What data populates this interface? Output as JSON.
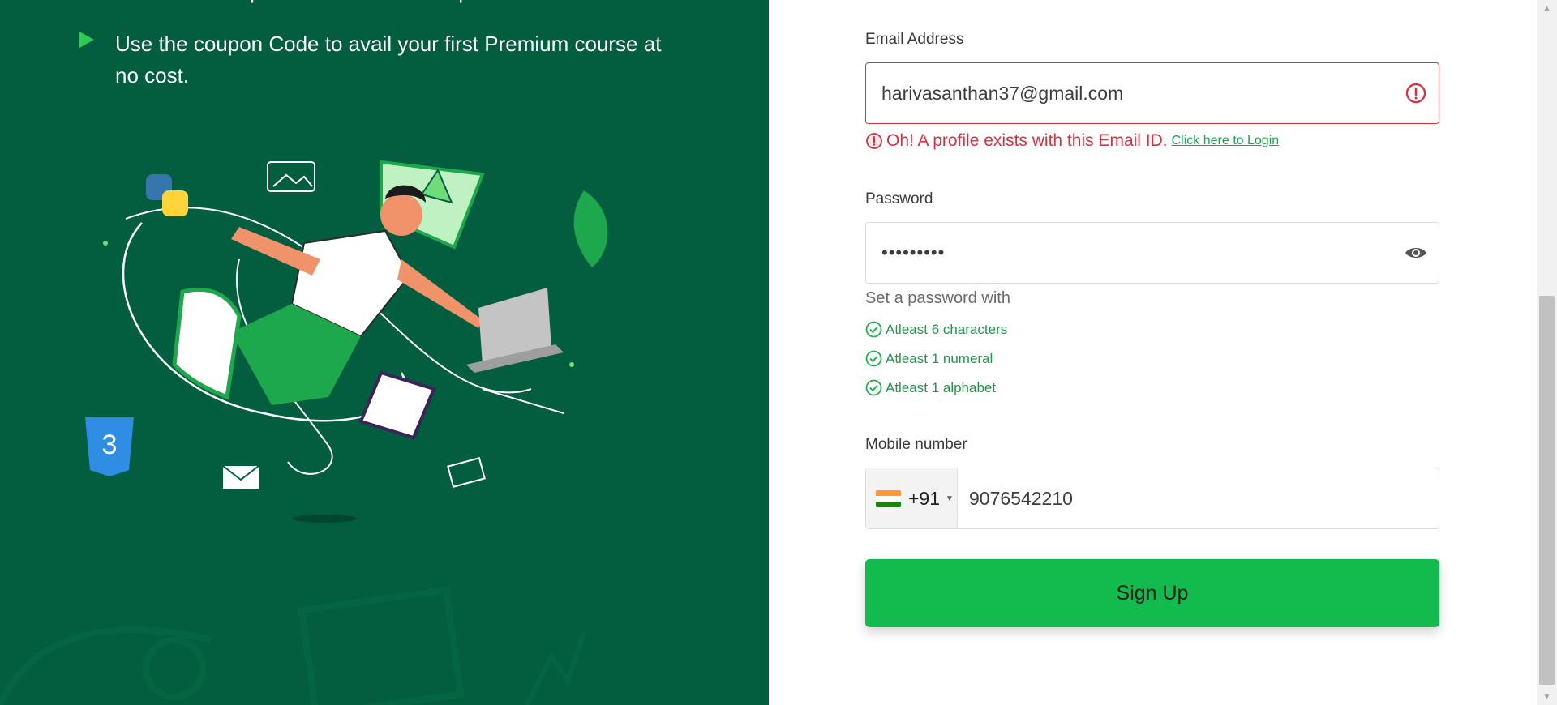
{
  "promo": {
    "bullets": [
      {
        "text": "Get access to premium courses and perks"
      },
      {
        "text": "Use the coupon Code to avail your first Premium course at no cost."
      }
    ]
  },
  "form": {
    "email": {
      "label": "Email Address",
      "value": "harivasanthan37@gmail.com",
      "error": "Oh! A profile exists with this Email ID.",
      "error_link": "Click here to Login"
    },
    "password": {
      "label": "Password",
      "value": "•••••••••",
      "hint_title": "Set a password with",
      "rules": [
        {
          "text": "Atleast 6 characters"
        },
        {
          "text": "Atleast 1 numeral"
        },
        {
          "text": "Atleast 1 alphabet"
        }
      ]
    },
    "mobile": {
      "label": "Mobile number",
      "country_code": "+91",
      "value": "9076542210"
    },
    "submit_label": "Sign Up"
  },
  "colors": {
    "left_panel_bg": "#035e3f",
    "accent_green": "#13ba4d",
    "error_red": "#dc2f3d",
    "rule_green": "#1b9a4b"
  },
  "icons": {
    "bullet": "play-triangle-icon",
    "email_error": "alert-circle-icon",
    "password_toggle": "eye-icon",
    "rule_check": "check-circle-icon",
    "country_flag": "india-flag-icon"
  }
}
